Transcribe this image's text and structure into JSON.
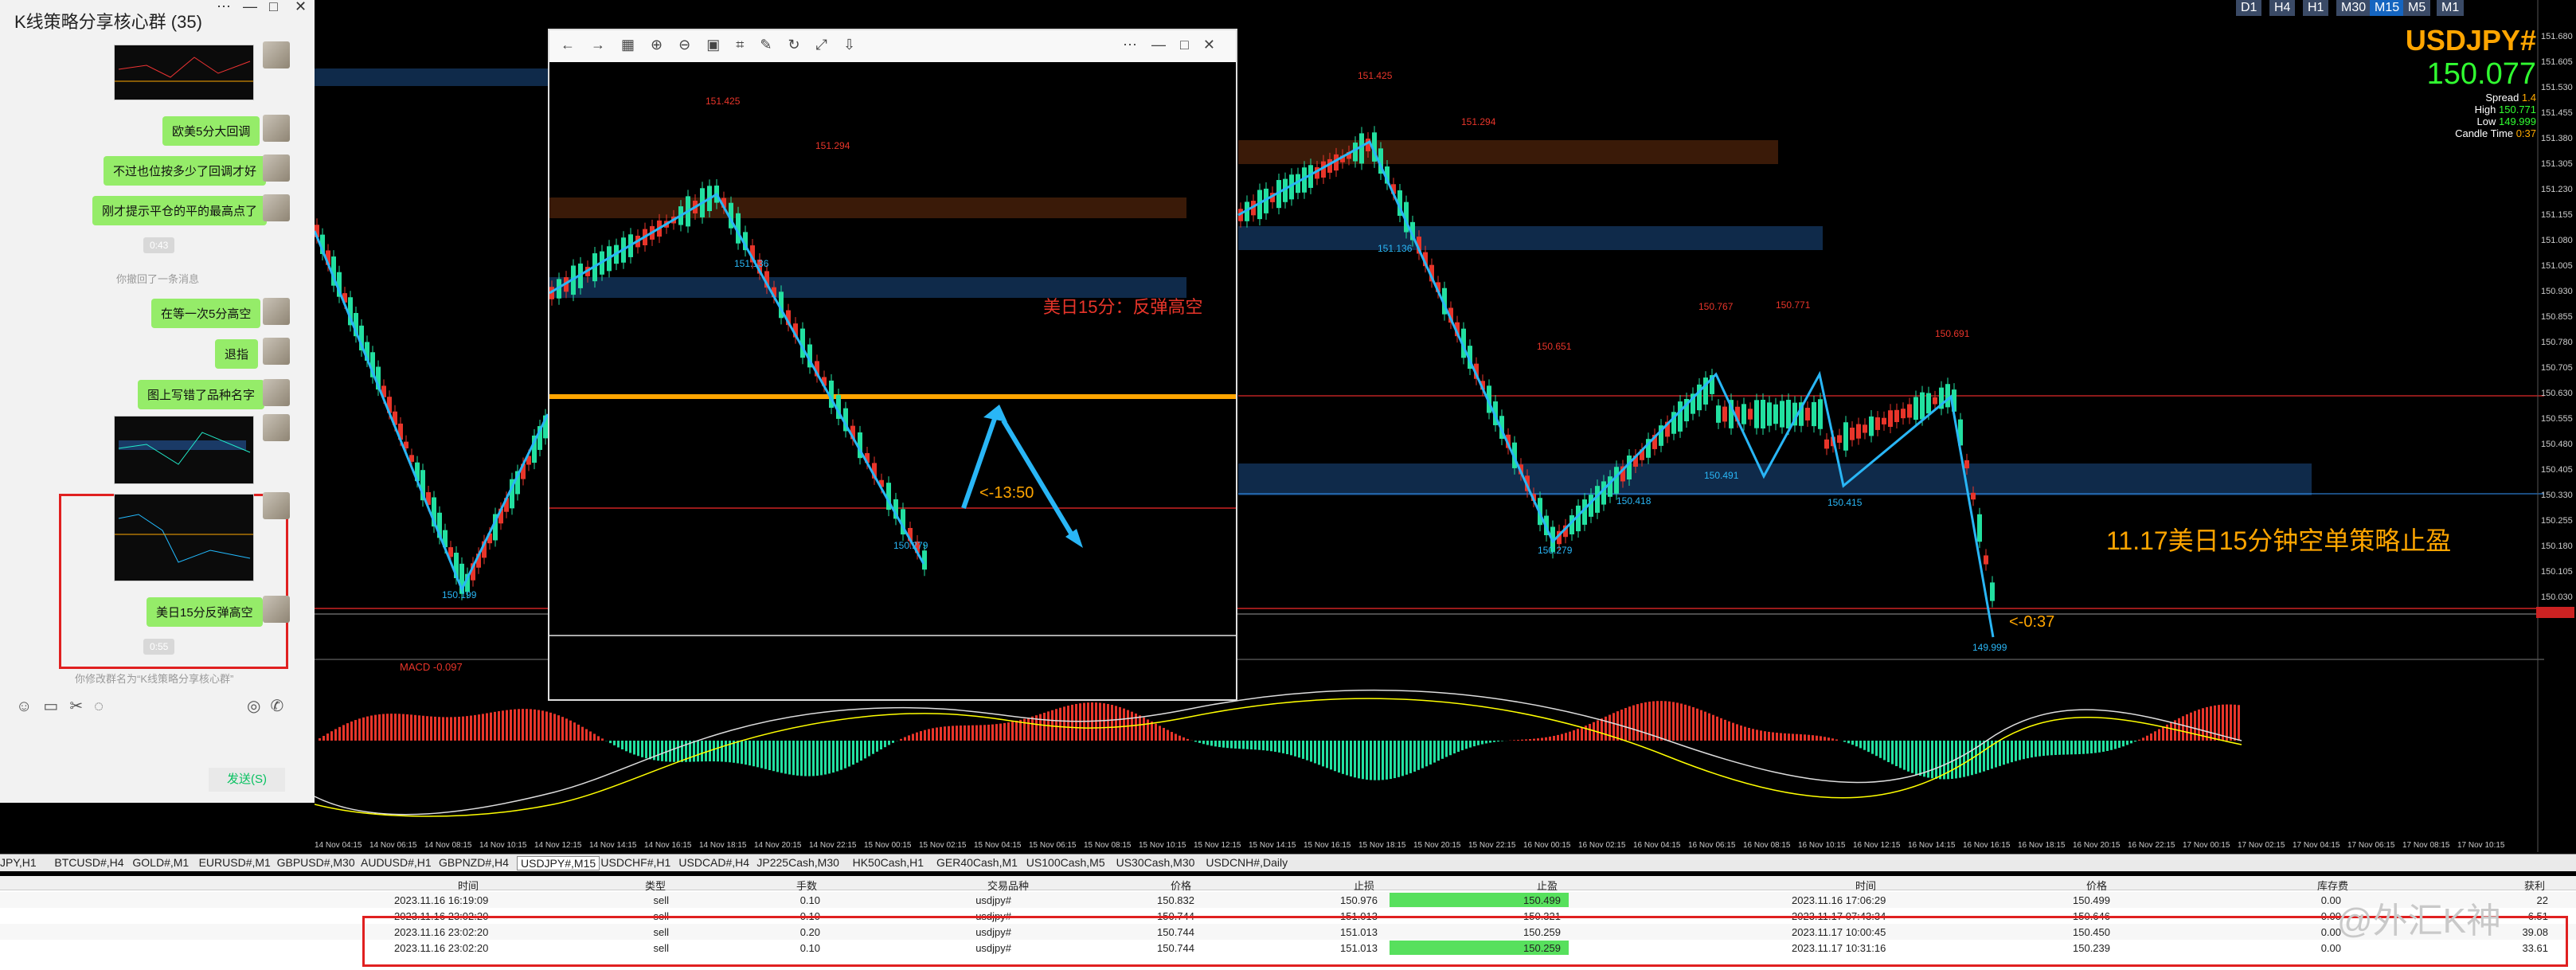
{
  "chat": {
    "title": "K线策略分享核心群 (35)",
    "messages": [
      "欧美5分大回调",
      "不过也位按多少了回调才好",
      "刚才提示平仓的平的最高点了",
      "在等一次5分高空",
      "退指",
      "图上写错了品种名字",
      "美日15分反弹高空"
    ],
    "time_pills": [
      "0:43",
      "0:55"
    ],
    "system_recall": "你撤回了一条消息",
    "system_rename": "你修改群名为“K线策略分享核心群”",
    "send_button": "发送(S)"
  },
  "chart": {
    "symbol": "USDJPY#",
    "price": "150.077",
    "spread_label": "Spread",
    "spread": "1.4",
    "high_label": "High",
    "high": "150.771",
    "low_label": "Low",
    "low": "149.999",
    "candle_label": "Candle Time",
    "candle": "0:37",
    "timeframes": [
      "D1",
      "H4",
      "H1",
      "M30",
      "M15",
      "M5",
      "M1"
    ],
    "annotations": {
      "popup_note": "美日15分：反弹高空",
      "popup_timer": "<-13:50",
      "main_note": "11.17美日15分钟空单策略止盈",
      "main_timer": "<-0:37",
      "macd": "MACD -0.097"
    },
    "price_labels": [
      "151.425",
      "151.294",
      "151.136",
      "150.279",
      "150.199",
      "150.651",
      "150.767",
      "150.771",
      "150.691",
      "150.418",
      "150.491",
      "150.415",
      "149.999"
    ],
    "axis_ticks": [
      "151.680",
      "151.605",
      "151.530",
      "151.455",
      "151.380",
      "151.305",
      "151.230",
      "151.155",
      "151.080",
      "151.005",
      "150.930",
      "150.855",
      "150.780",
      "150.705",
      "150.630",
      "150.555",
      "150.480",
      "150.405",
      "150.330",
      "150.255",
      "150.180",
      "150.105",
      "150.030"
    ],
    "time_ticks": [
      "14 Nov 04:15",
      "14 Nov 06:15",
      "14 Nov 08:15",
      "14 Nov 10:15",
      "14 Nov 12:15",
      "14 Nov 14:15",
      "14 Nov 16:15",
      "14 Nov 18:15",
      "14 Nov 20:15",
      "14 Nov 22:15",
      "15 Nov 00:15",
      "15 Nov 02:15",
      "15 Nov 04:15",
      "15 Nov 06:15",
      "15 Nov 08:15",
      "15 Nov 10:15",
      "15 Nov 12:15",
      "15 Nov 14:15",
      "15 Nov 16:15",
      "15 Nov 18:15",
      "15 Nov 20:15",
      "15 Nov 22:15",
      "16 Nov 00:15",
      "16 Nov 02:15",
      "16 Nov 04:15",
      "16 Nov 06:15",
      "16 Nov 08:15",
      "16 Nov 10:15",
      "16 Nov 12:15",
      "16 Nov 14:15",
      "16 Nov 16:15",
      "16 Nov 18:15",
      "16 Nov 20:15",
      "16 Nov 22:15",
      "17 Nov 00:15",
      "17 Nov 02:15",
      "17 Nov 04:15",
      "17 Nov 06:15",
      "17 Nov 08:15",
      "17 Nov 10:15"
    ]
  },
  "tabs": [
    "JPY,H1",
    "BTCUSD#,H4",
    "GOLD#,M1",
    "EURUSD#,M1",
    "GBPUSD#,M30",
    "AUDUSD#,H1",
    "GBPNZD#,H4",
    "USDJPY#,M15",
    "USDCHF#,H1",
    "USDCAD#,H4",
    "JP225Cash,M30",
    "HK50Cash,H1",
    "GER40Cash,M1",
    "US100Cash,M5",
    "US30Cash,M30",
    "USDCNH#,Daily"
  ],
  "terminal": {
    "headers": [
      "时间",
      "类型",
      "手数",
      "交易品种",
      "价格",
      "止损",
      "止盈",
      "时间",
      "价格",
      "库存费",
      "获利"
    ],
    "rows": [
      [
        "2023.11.16 16:19:09",
        "sell",
        "0.10",
        "usdjpy#",
        "150.832",
        "150.976",
        "150.499",
        "2023.11.16 17:06:29",
        "150.499",
        "0.00",
        "22"
      ],
      [
        "2023.11.16 23:02:20",
        "sell",
        "0.10",
        "usdjpy#",
        "150.744",
        "151.013",
        "150.321",
        "2023.11.17 07:43:34",
        "150.646",
        "0.00",
        "6.51"
      ],
      [
        "2023.11.16 23:02:20",
        "sell",
        "0.20",
        "usdjpy#",
        "150.744",
        "151.013",
        "150.259",
        "2023.11.17 10:00:45",
        "150.450",
        "0.00",
        "39.08"
      ],
      [
        "2023.11.16 23:02:20",
        "sell",
        "0.10",
        "usdjpy#",
        "150.744",
        "151.013",
        "150.259",
        "2023.11.17 10:31:16",
        "150.239",
        "0.00",
        "33.61"
      ]
    ],
    "watermark": "@外汇K神"
  },
  "colors": {
    "bull": "#22e0a0",
    "bear": "#e8352a",
    "zigzag": "#29b6f6",
    "orange": "#ffa500",
    "price_green": "#31ff31"
  }
}
